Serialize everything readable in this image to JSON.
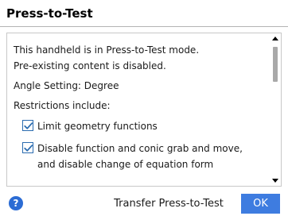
{
  "dialog": {
    "title": "Press-to-Test"
  },
  "content": {
    "intro_line1": "This handheld is in Press-to-Test mode.",
    "intro_line2": "Pre-existing content is disabled.",
    "angle_setting": "Angle Setting: Degree",
    "restrictions_heading": "Restrictions include:",
    "restrictions": [
      {
        "checked": true,
        "line1": "Limit geometry functions",
        "line2": ""
      },
      {
        "checked": true,
        "line1": "Disable function and conic grab and move,",
        "line2": "and disable change of equation form"
      }
    ]
  },
  "footer": {
    "help_glyph": "?",
    "transfer_label": "Transfer Press-to-Test",
    "ok_label": "OK"
  },
  "colors": {
    "accent": "#3e7ce0",
    "help_icon": "#2b6cd4",
    "checkbox_border": "#2b6cb0",
    "scroll_thumb": "#a9a9a9"
  },
  "icons": {
    "help": "help-icon",
    "checkbox": "checkmark-icon",
    "scroll_up": "scroll-up-arrow-icon",
    "scroll_down": "scroll-down-arrow-icon"
  }
}
